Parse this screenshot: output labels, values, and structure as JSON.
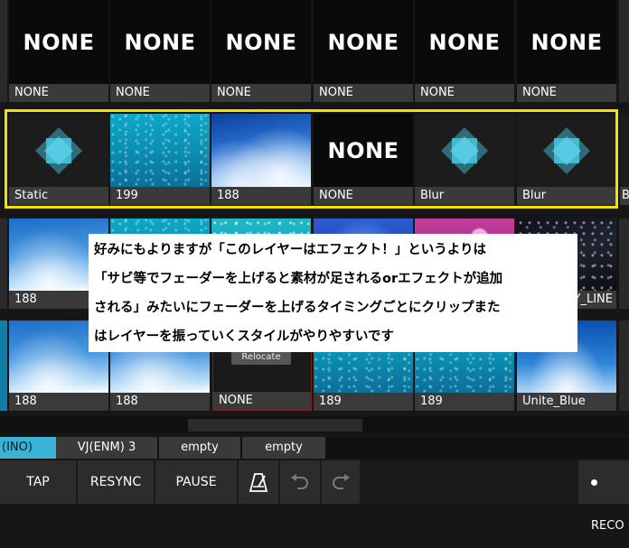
{
  "rows": [
    {
      "clips": [
        {
          "label": "NONE",
          "kind": "none",
          "thumb_text": "NONE"
        },
        {
          "label": "NONE",
          "kind": "none",
          "thumb_text": "NONE"
        },
        {
          "label": "NONE",
          "kind": "none",
          "thumb_text": "NONE"
        },
        {
          "label": "NONE",
          "kind": "none",
          "thumb_text": "NONE"
        },
        {
          "label": "NONE",
          "kind": "none",
          "thumb_text": "NONE"
        },
        {
          "label": "NONE",
          "kind": "none",
          "thumb_text": "NONE"
        }
      ]
    },
    {
      "clips": [
        {
          "label": "Static",
          "kind": "effect"
        },
        {
          "label": "199",
          "kind": "water"
        },
        {
          "label": "188",
          "kind": "sky"
        },
        {
          "label": "NONE",
          "kind": "none",
          "thumb_text": "NONE"
        },
        {
          "label": "Blur",
          "kind": "effect"
        },
        {
          "label": "Blur",
          "kind": "effect"
        },
        {
          "label": "B",
          "kind": "partial"
        }
      ]
    },
    {
      "clips": [
        {
          "label": "188",
          "kind": "sky2"
        },
        {
          "label": "",
          "kind": "water"
        },
        {
          "label": "",
          "kind": "cyanstar"
        },
        {
          "label": "",
          "kind": "blueglow"
        },
        {
          "label": "",
          "kind": "flowers"
        },
        {
          "label": "Y_LINE",
          "kind": "space"
        }
      ]
    },
    {
      "clips": [
        {
          "label": "188",
          "kind": "sky2"
        },
        {
          "label": "188",
          "kind": "sky2"
        },
        {
          "label": "NONE",
          "kind": "dark",
          "overlay": "Relocate"
        },
        {
          "label": "189",
          "kind": "water"
        },
        {
          "label": "189",
          "kind": "water"
        },
        {
          "label": "Unite_Blue",
          "kind": "skyblue"
        }
      ]
    }
  ],
  "annotation": {
    "lines": [
      "好みにもよりますが「このレイヤーはエフェクト！」というよりは",
      "「サビ等でフェーダーを上げると素材が足されるorエフェクトが追加",
      "される」みたいにフェーダーを上げるタイミングごとにクリップまた",
      "はレイヤーを振っていくスタイルがやりやすいです"
    ]
  },
  "tabs": [
    {
      "label": "(INO)",
      "active": true
    },
    {
      "label": "VJ(ENM) 3",
      "active": false
    },
    {
      "label": "empty",
      "active": false
    },
    {
      "label": "empty",
      "active": false
    }
  ],
  "toolbar": {
    "tap": "TAP",
    "resync": "RESYNC",
    "pause": "PAUSE",
    "metronome_icon": "metronome-icon",
    "undo_icon": "undo-icon",
    "redo_icon": "redo-icon",
    "record": "RECO"
  },
  "colors": {
    "highlight": "#f6e000",
    "active_tab": "#39b4d6",
    "diamond_outer": "#2d6c78",
    "diamond_inner": "#45c3dc"
  }
}
